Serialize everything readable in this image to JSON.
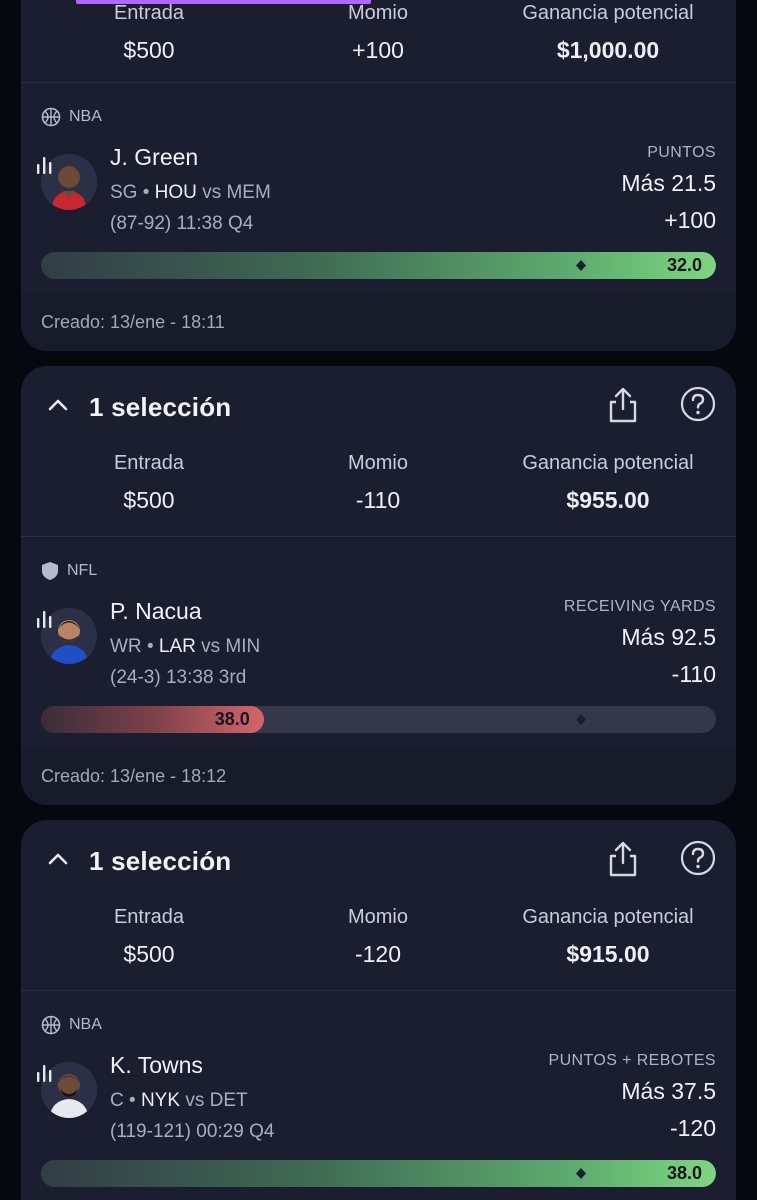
{
  "cards": [
    {
      "header": null,
      "stats": {
        "entry_label": "Entrada",
        "entry_value": "$500",
        "odds_label": "Momio",
        "odds_value": "+100",
        "payout_label": "Ganancia potencial",
        "payout_value": "$1,000.00"
      },
      "league": "NBA",
      "player": {
        "name": "J. Green",
        "position": "SG",
        "team": "HOU",
        "vs": "vs",
        "opponent": "MEM",
        "score": "(87-92)",
        "clock": "11:38 Q4"
      },
      "market": {
        "type": "PUNTOS",
        "line": "Más 21.5",
        "odds": "+100"
      },
      "progress": {
        "value": "32.0",
        "fraction": 1.0,
        "status": "winning"
      },
      "created": "Creado: 13/ene - 18:11"
    },
    {
      "header": {
        "title": "1 selección"
      },
      "stats": {
        "entry_label": "Entrada",
        "entry_value": "$500",
        "odds_label": "Momio",
        "odds_value": "-110",
        "payout_label": "Ganancia potencial",
        "payout_value": "$955.00"
      },
      "league": "NFL",
      "player": {
        "name": "P. Nacua",
        "position": "WR",
        "team": "LAR",
        "vs": "vs",
        "opponent": "MIN",
        "score": "(24-3)",
        "clock": "13:38 3rd"
      },
      "market": {
        "type": "RECEIVING YARDS",
        "line": "Más 92.5",
        "odds": "-110"
      },
      "progress": {
        "value": "38.0",
        "fraction": 0.33,
        "status": "losing"
      },
      "created": "Creado: 13/ene - 18:12"
    },
    {
      "header": {
        "title": "1 selección"
      },
      "stats": {
        "entry_label": "Entrada",
        "entry_value": "$500",
        "odds_label": "Momio",
        "odds_value": "-120",
        "payout_label": "Ganancia potencial",
        "payout_value": "$915.00"
      },
      "league": "NBA",
      "player": {
        "name": "K. Towns",
        "position": "C",
        "team": "NYK",
        "vs": "vs",
        "opponent": "DET",
        "score": "(119-121)",
        "clock": "00:29 Q4"
      },
      "market": {
        "type": "PUNTOS + REBOTES",
        "line": "Más 37.5",
        "odds": "-120"
      },
      "progress": {
        "value": "38.0",
        "fraction": 1.0,
        "status": "winning"
      }
    }
  ],
  "colors": {
    "card_bg": "#1b1e2f",
    "page_bg": "#06080f",
    "win_green": "#7ed67f",
    "lose_red": "#d7656a",
    "accent_purple": "#b266ff"
  },
  "icons": {
    "collapse": "chevron-up-icon",
    "share": "share-icon",
    "help": "help-circle-icon",
    "stats": "bar-chart-icon",
    "nba": "basketball-icon",
    "nfl": "shield-icon"
  }
}
